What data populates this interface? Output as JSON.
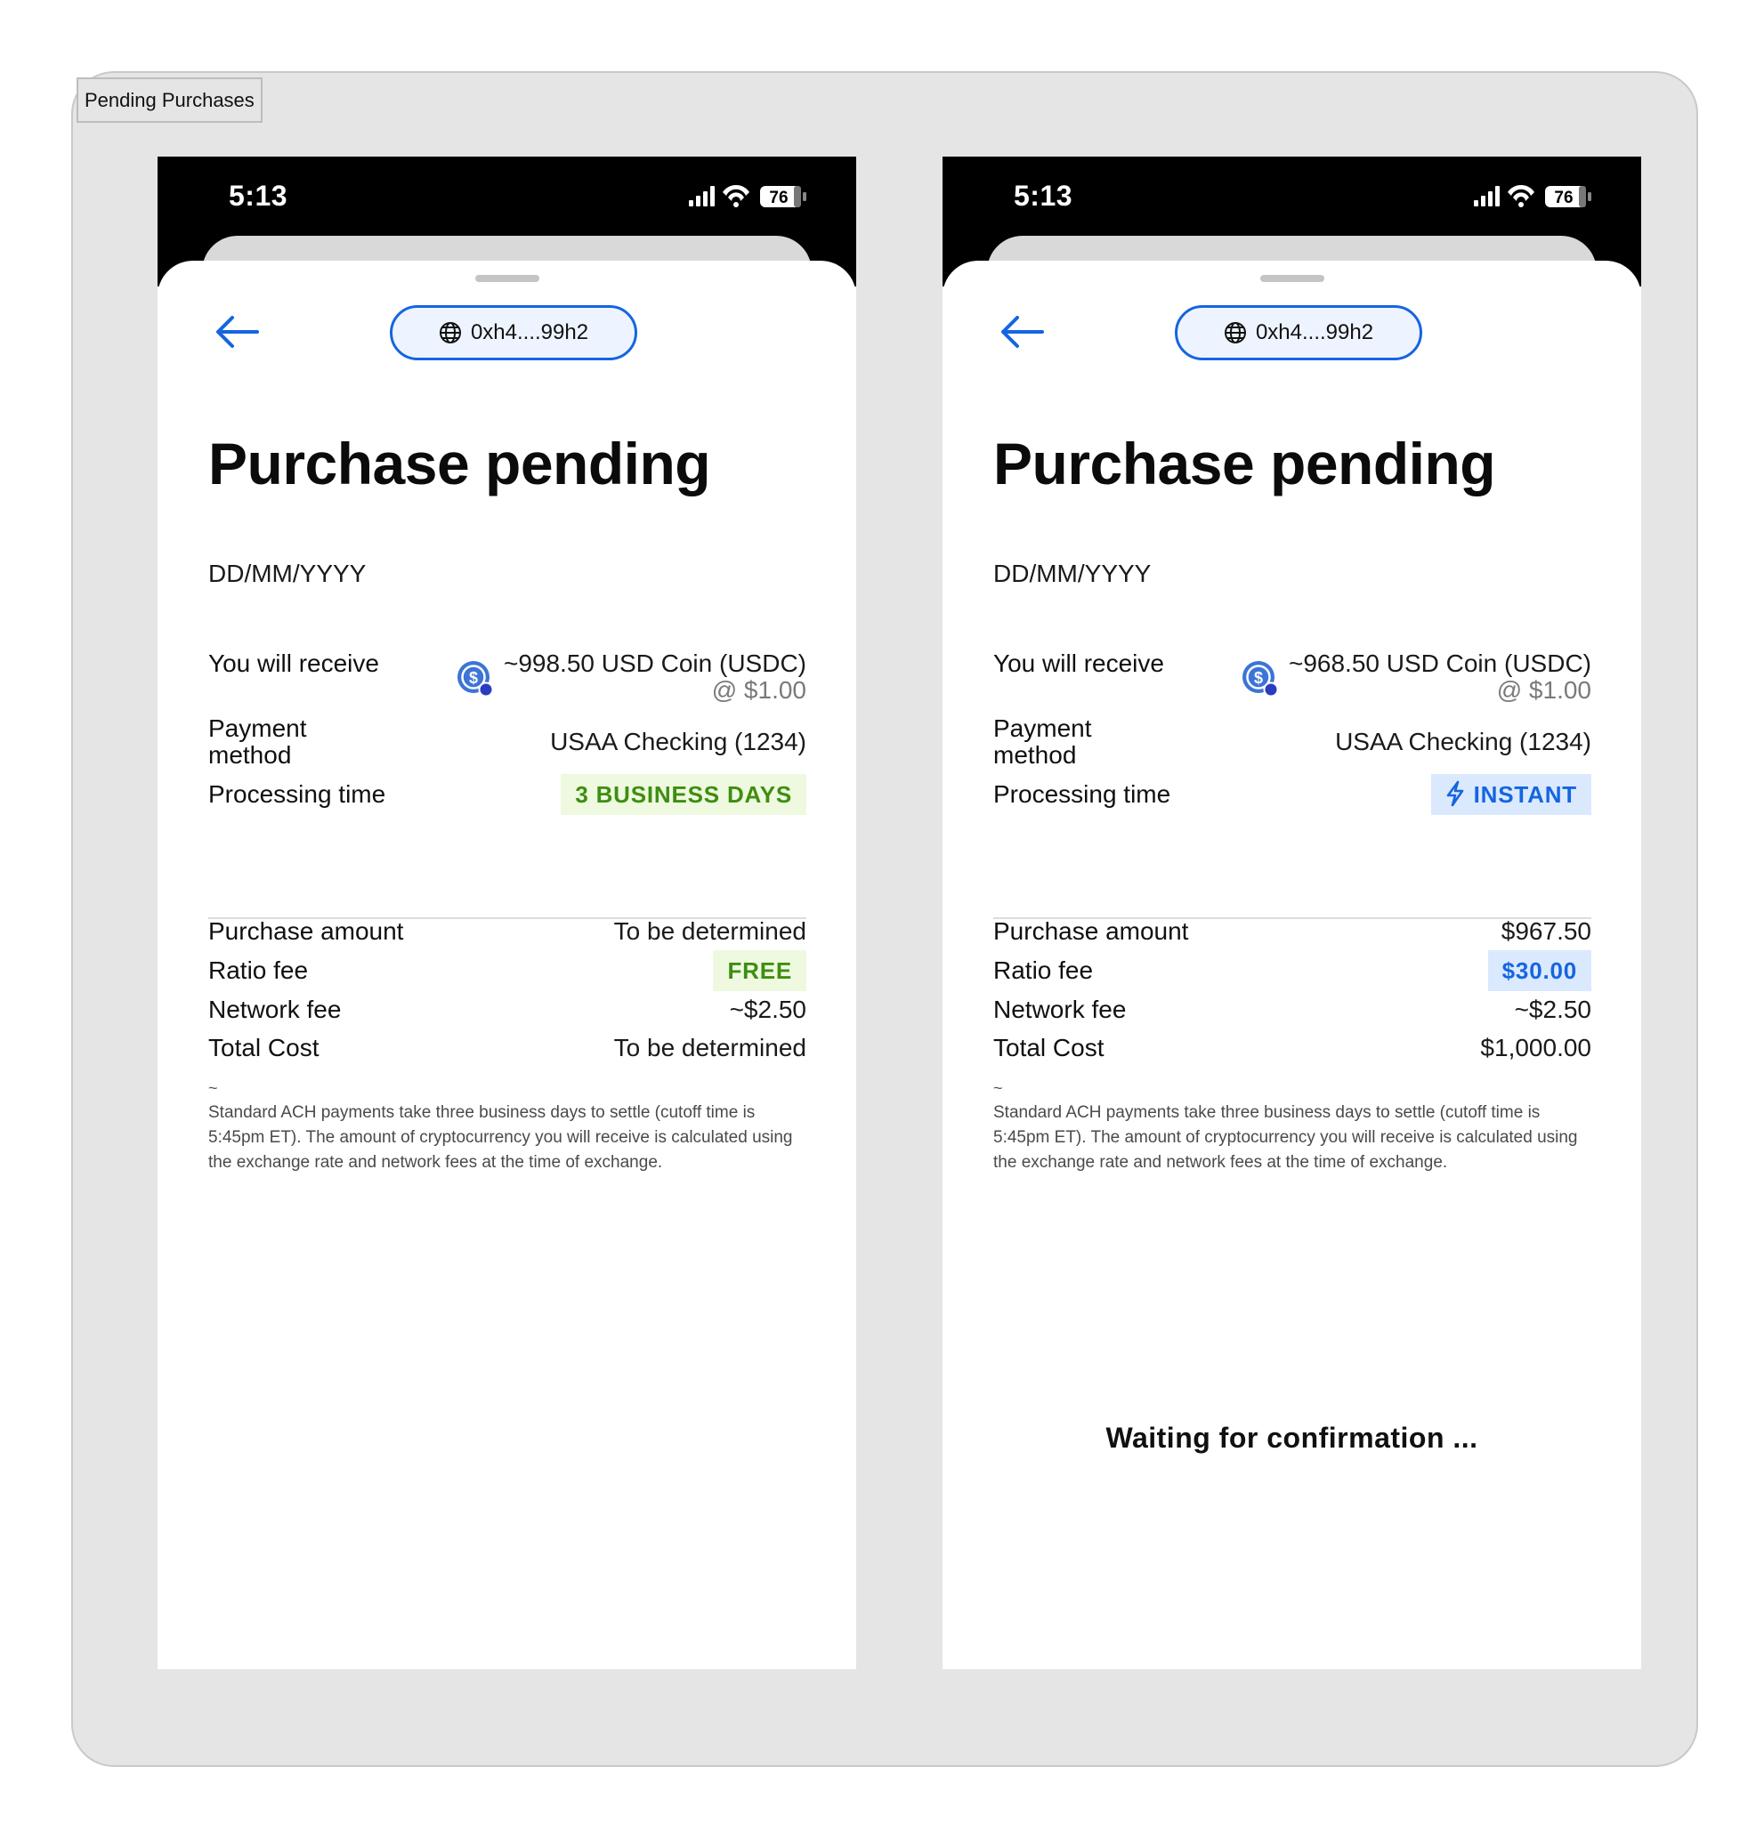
{
  "frame": {
    "label": "Pending Purchases"
  },
  "screens": [
    {
      "status": {
        "time": "5:13",
        "battery": "76"
      },
      "wallet": "0xh4....99h2",
      "title": "Purchase pending",
      "date": "DD/MM/YYYY",
      "receive": {
        "label": "You will receive",
        "amount": "~998.50 USD Coin (USDC)",
        "rate": "@ $1.00"
      },
      "payment": {
        "label_line1": "Payment",
        "label_line2": "method",
        "value": "USAA Checking (1234)"
      },
      "processing": {
        "label": "Processing time",
        "value": "3 BUSINESS DAYS",
        "style": "green"
      },
      "purchase_amount": {
        "label": "Purchase amount",
        "value": "To be determined"
      },
      "ratio_fee": {
        "label": "Ratio fee",
        "value": "FREE",
        "style": "green"
      },
      "network_fee": {
        "label": "Network fee",
        "value": "~$2.50"
      },
      "total_cost": {
        "label": "Total Cost",
        "value": "To be determined"
      },
      "footnote_mark": "~",
      "footnote": "Standard ACH payments take three business days to settle (cutoff time is 5:45pm ET). The amount of cryptocurrency you will receive is calculated using the exchange rate and network fees at the time of exchange.",
      "waiting": ""
    },
    {
      "status": {
        "time": "5:13",
        "battery": "76"
      },
      "wallet": "0xh4....99h2",
      "title": "Purchase pending",
      "date": "DD/MM/YYYY",
      "receive": {
        "label": "You will receive",
        "amount": "~968.50 USD Coin (USDC)",
        "rate": "@ $1.00"
      },
      "payment": {
        "label_line1": "Payment",
        "label_line2": "method",
        "value": "USAA Checking (1234)"
      },
      "processing": {
        "label": "Processing time",
        "value": "INSTANT",
        "style": "blue"
      },
      "purchase_amount": {
        "label": "Purchase amount",
        "value": "$967.50"
      },
      "ratio_fee": {
        "label": "Ratio fee",
        "value": "$30.00",
        "style": "blue"
      },
      "network_fee": {
        "label": "Network fee",
        "value": "~$2.50"
      },
      "total_cost": {
        "label": "Total Cost",
        "value": "$1,000.00"
      },
      "footnote_mark": "~",
      "footnote": "Standard ACH payments take three business days to settle (cutoff time is 5:45pm ET). The amount of cryptocurrency you will receive is calculated using the exchange rate and network fees at the time of exchange.",
      "waiting": "Waiting for confirmation ..."
    }
  ],
  "colors": {
    "accent_blue": "#1565e0",
    "green_text": "#3e8e10",
    "green_bg": "#eef9e0",
    "blue_bg": "#dbe9ff",
    "frame_bg": "#e5e5e5"
  },
  "icons": [
    "back-arrow-icon",
    "globe-icon",
    "usdc-coin-icon",
    "lightning-bolt-icon",
    "signal-icon",
    "wifi-icon",
    "battery-icon"
  ]
}
